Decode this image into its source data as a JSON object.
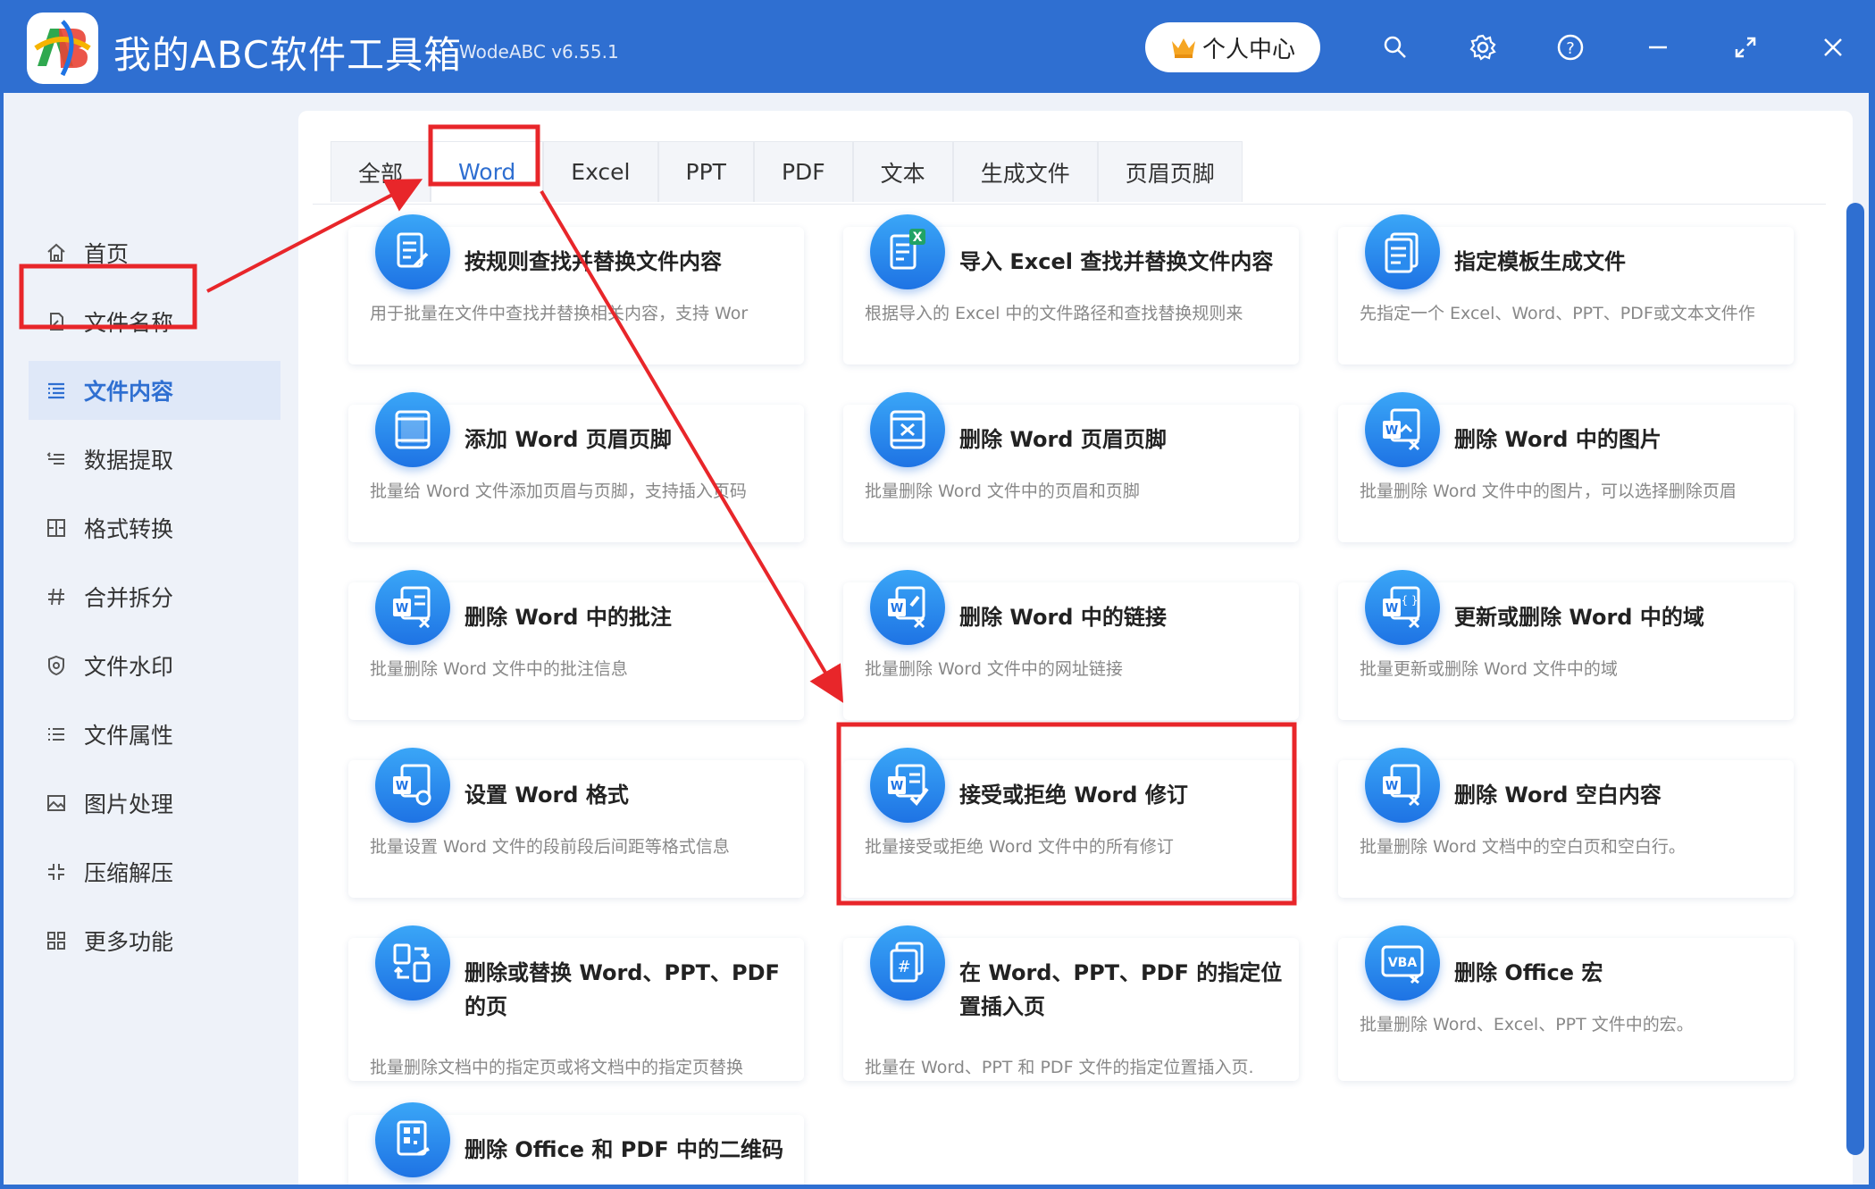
{
  "app": {
    "title": "我的ABC软件工具箱",
    "version": "WodeABC v6.55.1",
    "user_center": "个人中心"
  },
  "sidebar": {
    "items": [
      {
        "label": "首页",
        "icon": "home-icon"
      },
      {
        "label": "文件名称",
        "icon": "file-name-icon"
      },
      {
        "label": "文件内容",
        "icon": "file-content-icon",
        "active": true
      },
      {
        "label": "数据提取",
        "icon": "data-extract-icon"
      },
      {
        "label": "格式转换",
        "icon": "format-convert-icon"
      },
      {
        "label": "合并拆分",
        "icon": "merge-split-icon"
      },
      {
        "label": "文件水印",
        "icon": "watermark-icon"
      },
      {
        "label": "文件属性",
        "icon": "file-properties-icon"
      },
      {
        "label": "图片处理",
        "icon": "image-process-icon"
      },
      {
        "label": "压缩解压",
        "icon": "compress-icon"
      },
      {
        "label": "更多功能",
        "icon": "more-functions-icon"
      }
    ]
  },
  "tabs": [
    "全部",
    "Word",
    "Excel",
    "PPT",
    "PDF",
    "文本",
    "生成文件",
    "页眉页脚"
  ],
  "active_tab": "Word",
  "cards": [
    {
      "title": "按规则查找并替换文件内容",
      "desc": "用于批量在文件中查找并替换相关内容，支持 Wor",
      "icon": "find-replace-icon"
    },
    {
      "title": "导入 Excel 查找并替换文件内容",
      "desc": "根据导入的 Excel 中的文件路径和查找替换规则来",
      "icon": "excel-import-icon"
    },
    {
      "title": "指定模板生成文件",
      "desc": "先指定一个 Excel、Word、PPT、PDF或文本文件作",
      "icon": "template-icon"
    },
    {
      "title": "添加 Word 页眉页脚",
      "desc": "批量给 Word 文件添加页眉与页脚，支持插入页码",
      "icon": "add-header-footer-icon"
    },
    {
      "title": "删除 Word 页眉页脚",
      "desc": "批量删除 Word 文件中的页眉和页脚",
      "icon": "delete-header-footer-icon"
    },
    {
      "title": "删除 Word 中的图片",
      "desc": "批量删除 Word 文件中的图片，可以选择删除页眉",
      "icon": "delete-image-icon"
    },
    {
      "title": "删除 Word 中的批注",
      "desc": "批量删除 Word 文件中的批注信息",
      "icon": "delete-comment-icon"
    },
    {
      "title": "删除 Word 中的链接",
      "desc": "批量删除 Word 文件中的网址链接",
      "icon": "delete-link-icon"
    },
    {
      "title": "更新或删除 Word 中的域",
      "desc": "批量更新或删除 Word 文件中的域",
      "icon": "field-icon"
    },
    {
      "title": "设置 Word 格式",
      "desc": "批量设置 Word 文件的段前段后间距等格式信息",
      "icon": "word-format-icon"
    },
    {
      "title": "接受或拒绝 Word 修订",
      "desc": "批量接受或拒绝 Word 文件中的所有修订",
      "icon": "accept-revision-icon"
    },
    {
      "title": "删除 Word 空白内容",
      "desc": "批量删除 Word 文档中的空白页和空白行。",
      "icon": "delete-blank-icon"
    },
    {
      "title": "删除或替换 Word、PPT、PDF 的页",
      "desc": "批量删除文档中的指定页或将文档中的指定页替换",
      "icon": "replace-page-icon"
    },
    {
      "title": "在 Word、PPT、PDF 的指定位置插入页",
      "desc": "批量在 Word、PPT 和 PDF 文件的指定位置插入页.",
      "icon": "insert-page-icon"
    },
    {
      "title": "删除 Office 宏",
      "desc": "批量删除 Word、Excel、PPT 文件中的宏。",
      "icon": "vba-macro-icon"
    },
    {
      "title": "删除 Office 和 PDF 中的二维码",
      "desc": "",
      "icon": "qrcode-icon"
    }
  ],
  "colors": {
    "brand": "#2f6fd1",
    "annotation": "#e8262a"
  }
}
